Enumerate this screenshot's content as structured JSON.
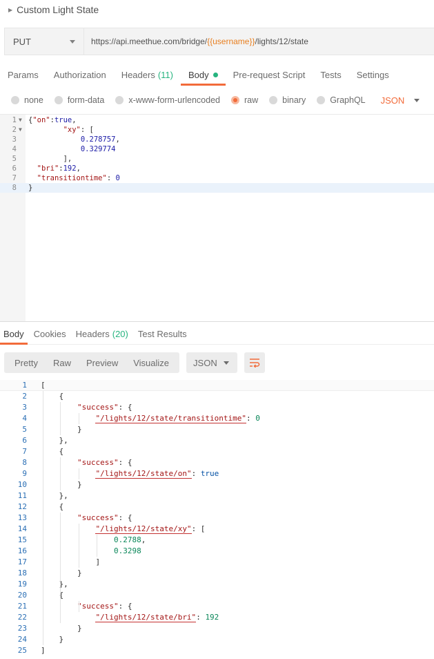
{
  "request": {
    "title": "Custom Light State",
    "method": "PUT",
    "url_prefix": "https://api.meethue.com/bridge/",
    "url_var": "{{username}}",
    "url_suffix": "/lights/12/state"
  },
  "tabs": [
    {
      "label": "Params",
      "count": ""
    },
    {
      "label": "Authorization",
      "count": ""
    },
    {
      "label": "Headers",
      "count": "(11)"
    },
    {
      "label": "Body",
      "count": ""
    },
    {
      "label": "Pre-request Script",
      "count": ""
    },
    {
      "label": "Tests",
      "count": ""
    },
    {
      "label": "Settings",
      "count": ""
    }
  ],
  "active_tab": "Body",
  "body_types": [
    "none",
    "form-data",
    "x-www-form-urlencoded",
    "raw",
    "binary",
    "GraphQL"
  ],
  "selected_body_type": "raw",
  "body_format": "JSON",
  "request_body_lines": [
    "{\"on\":true,",
    "        \"xy\": [",
    "            0.278757,",
    "            0.329774",
    "        ],",
    "  \"bri\":192,",
    "  \"transitiontime\": 0",
    "}"
  ],
  "response_tabs": [
    {
      "label": "Body",
      "count": ""
    },
    {
      "label": "Cookies",
      "count": ""
    },
    {
      "label": "Headers",
      "count": "(20)"
    },
    {
      "label": "Test Results",
      "count": ""
    }
  ],
  "response_views": [
    "Pretty",
    "Raw",
    "Preview",
    "Visualize"
  ],
  "response_format": "JSON",
  "response_lines": [
    "[",
    "    {",
    "        \"success\": {",
    "            \"/lights/12/state/transitiontime\": 0",
    "        }",
    "    },",
    "    {",
    "        \"success\": {",
    "            \"/lights/12/state/on\": true",
    "        }",
    "    },",
    "    {",
    "        \"success\": {",
    "            \"/lights/12/state/xy\": [",
    "                0.2788,",
    "                0.3298",
    "            ]",
    "        }",
    "    },",
    "    {",
    "        \"success\": {",
    "            \"/lights/12/state/bri\": 192",
    "        }",
    "    }",
    "]"
  ],
  "colors": {
    "accent": "#f26b3a",
    "count_green": "#26b47f",
    "variable_orange": "#e87f20"
  }
}
